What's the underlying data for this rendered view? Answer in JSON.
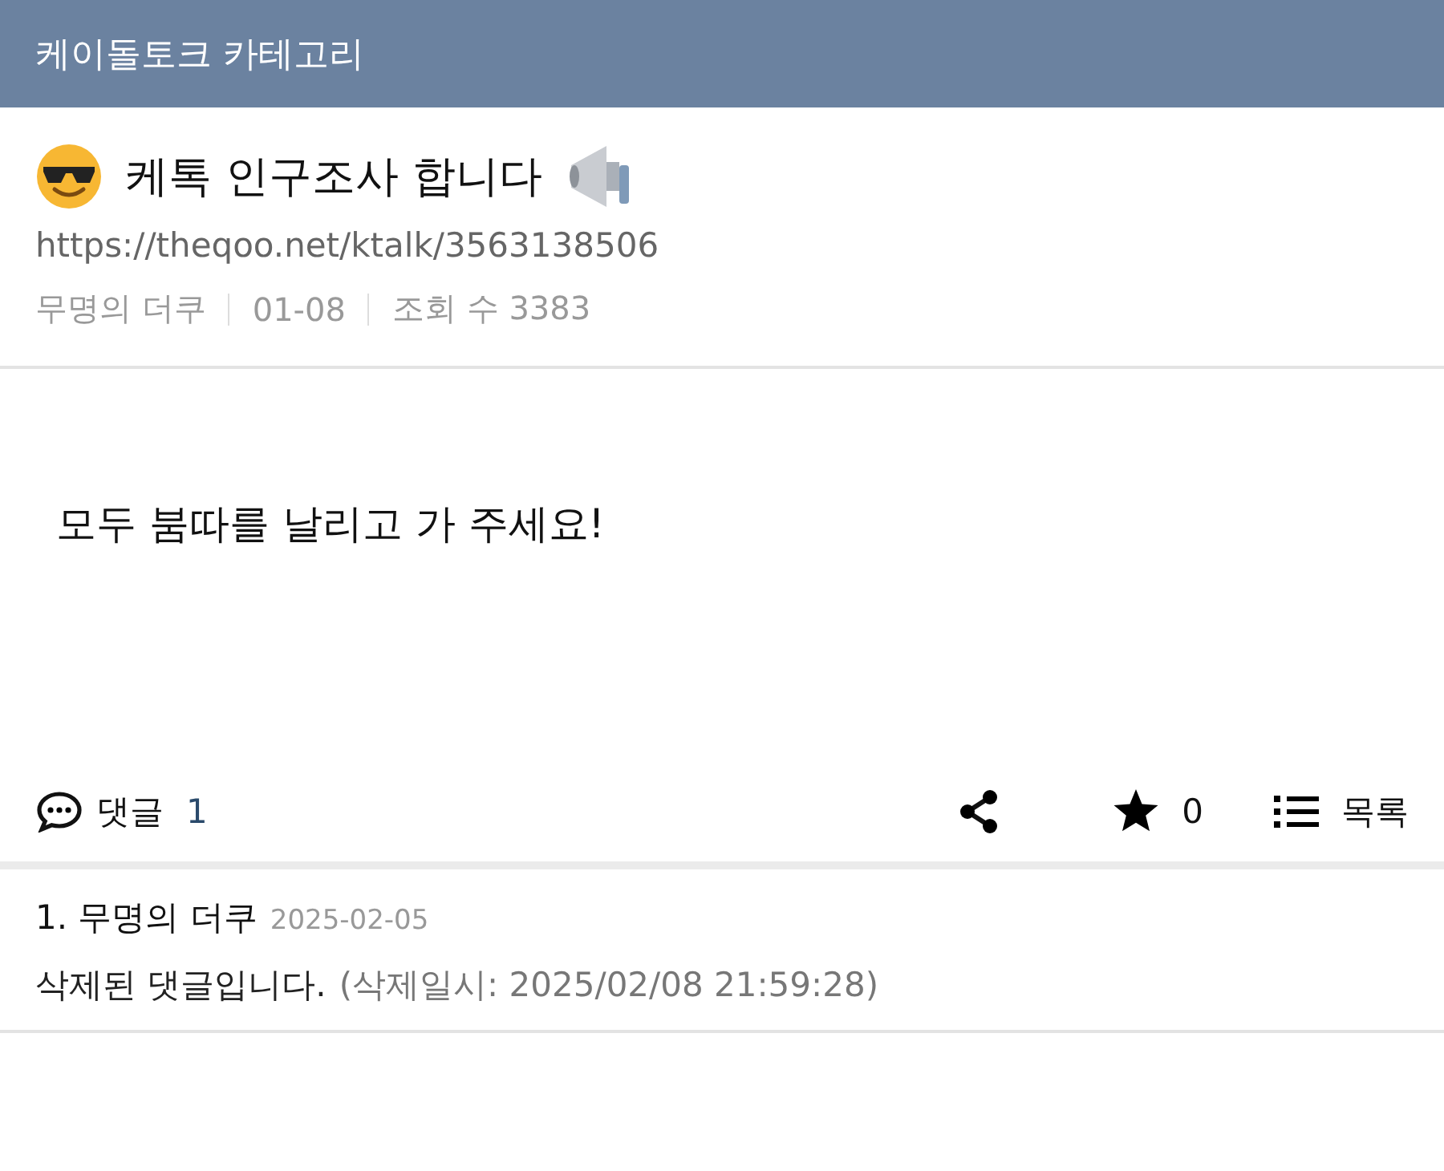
{
  "header": {
    "title": "케이돌토크 카테고리"
  },
  "post": {
    "title": "케톡 인구조사 합니다",
    "url": "https://theqoo.net/ktalk/3563138506",
    "author": "무명의 더쿠",
    "date": "01-08",
    "views": "조회 수 3383",
    "body": "모두 붐따를 날리고 가 주세요!"
  },
  "actions": {
    "comments_label": "댓글",
    "comments_count": "1",
    "stars": "0",
    "list_label": "목록"
  },
  "comments": [
    {
      "number_author": "1. 무명의 더쿠",
      "date": "2025-02-05",
      "text": "삭제된 댓글입니다.",
      "note": "(삭제일시: 2025/02/08 21:59:28)"
    }
  ]
}
